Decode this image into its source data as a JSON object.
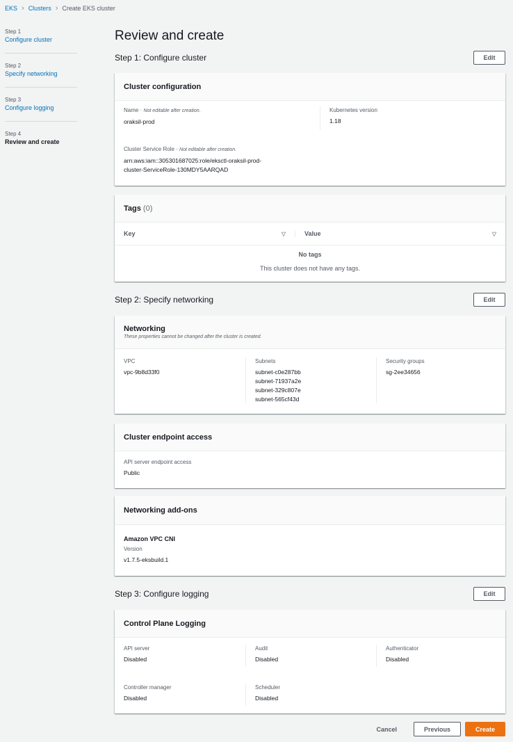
{
  "breadcrumb": {
    "items": [
      "EKS",
      "Clusters"
    ],
    "current": "Create EKS cluster"
  },
  "sidebar": {
    "steps": [
      {
        "num": "Step 1",
        "label": "Configure cluster"
      },
      {
        "num": "Step 2",
        "label": "Specify networking"
      },
      {
        "num": "Step 3",
        "label": "Configure logging"
      },
      {
        "num": "Step 4",
        "label": "Review and create"
      }
    ]
  },
  "page": {
    "title": "Review and create"
  },
  "edit_label": "Edit",
  "step1": {
    "title": "Step 1: Configure cluster",
    "config": {
      "title": "Cluster configuration",
      "name_label": "Name",
      "name_note": "Not editable after creation.",
      "name_value": "oraksil-prod",
      "k8s_label": "Kubernetes version",
      "k8s_value": "1.18",
      "role_label": "Cluster Service Role",
      "role_note": "Not editable after creation.",
      "role_value_1": "arn:aws:iam::305301687025:role/eksctl-oraksil-prod-",
      "role_value_2": "cluster-ServiceRole-130MDY5AARQAD"
    },
    "tags": {
      "title": "Tags",
      "count": "(0)",
      "col_key": "Key",
      "col_value": "Value",
      "empty_title": "No tags",
      "empty_sub": "This cluster does not have any tags."
    }
  },
  "step2": {
    "title": "Step 2: Specify networking",
    "networking": {
      "title": "Networking",
      "subtitle": "These properties cannot be changed after the cluster is created.",
      "vpc_label": "VPC",
      "vpc_value": "vpc-9b8d33f0",
      "subnets_label": "Subnets",
      "subnets": [
        "subnet-c0e287bb",
        "subnet-71937a2e",
        "subnet-329c807e",
        "subnet-565cf43d"
      ],
      "sg_label": "Security groups",
      "sg_value": "sg-2ee34656"
    },
    "endpoint": {
      "title": "Cluster endpoint access",
      "label": "API server endpoint access",
      "value": "Public"
    },
    "addons": {
      "title": "Networking add-ons",
      "name": "Amazon VPC CNI",
      "version_label": "Version",
      "version_value": "v1.7.5-eksbuild.1"
    }
  },
  "step3": {
    "title": "Step 3: Configure logging",
    "logging": {
      "title": "Control Plane Logging",
      "items": [
        {
          "label": "API server",
          "value": "Disabled"
        },
        {
          "label": "Audit",
          "value": "Disabled"
        },
        {
          "label": "Authenticator",
          "value": "Disabled"
        },
        {
          "label": "Controller manager",
          "value": "Disabled"
        },
        {
          "label": "Scheduler",
          "value": "Disabled"
        }
      ]
    }
  },
  "footer": {
    "cancel": "Cancel",
    "previous": "Previous",
    "create": "Create"
  }
}
